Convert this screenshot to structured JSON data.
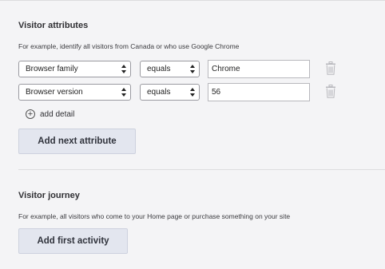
{
  "visitor_attributes": {
    "heading": "Visitor attributes",
    "help_text": "For example, identify all visitors from Canada or who use Google Chrome",
    "rows": [
      {
        "attribute": "Browser family",
        "operator": "equals",
        "value": "Chrome",
        "delete_icon": "trash-icon"
      },
      {
        "attribute": "Browser version",
        "operator": "equals",
        "value": "56",
        "delete_icon": "trash-icon"
      }
    ],
    "add_detail_label": "add detail",
    "add_next_button": "Add next attribute"
  },
  "visitor_journey": {
    "heading": "Visitor journey",
    "help_text": "For example, all visitors who come to your Home page or purchase something on your site",
    "add_first_button": "Add first activity"
  }
}
